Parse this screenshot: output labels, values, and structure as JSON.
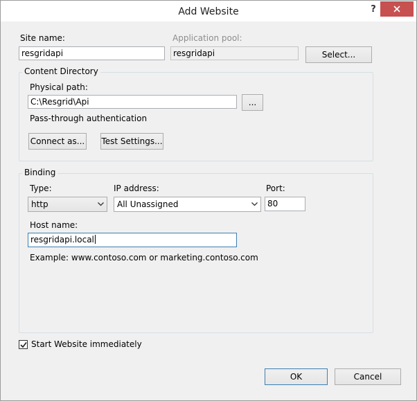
{
  "window": {
    "title": "Add Website",
    "help_glyph": "?"
  },
  "site_name": {
    "label": "Site name:",
    "value": "resgridapi"
  },
  "app_pool": {
    "label": "Application pool:",
    "value": "resgridapi",
    "select_label": "Select..."
  },
  "content_directory": {
    "group_title": "Content Directory",
    "physical_path_label": "Physical path:",
    "physical_path_value": "C:\\Resgrid\\Api",
    "browse_label": "...",
    "auth_text": "Pass-through authentication",
    "connect_as_label": "Connect as...",
    "test_settings_label": "Test Settings..."
  },
  "binding": {
    "group_title": "Binding",
    "type_label": "Type:",
    "type_value": "http",
    "ip_label": "IP address:",
    "ip_value": "All Unassigned",
    "port_label": "Port:",
    "port_value": "80",
    "host_label": "Host name:",
    "host_value": "resgridapi.local",
    "example_text": "Example: www.contoso.com or marketing.contoso.com"
  },
  "start_immediately": {
    "label": "Start Website immediately",
    "checked": true
  },
  "footer": {
    "ok_label": "OK",
    "cancel_label": "Cancel"
  },
  "icons": {
    "close": "close-icon",
    "dropdown": "chevron-down-icon",
    "check": "checkmark-icon"
  }
}
